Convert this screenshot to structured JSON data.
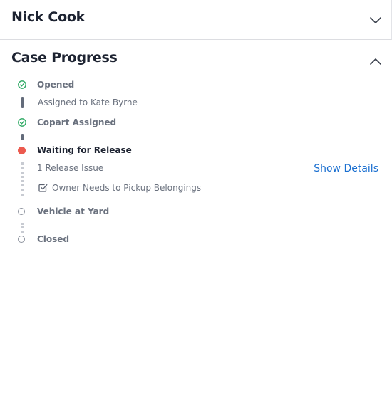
{
  "header": {
    "title": "Nick Cook"
  },
  "case_progress": {
    "title": "Case Progress",
    "steps": [
      {
        "label": "Opened",
        "status": "complete",
        "detail": "Assigned to Kate Byrne"
      },
      {
        "label": "Copart Assigned",
        "status": "complete"
      },
      {
        "label": "Waiting for Release",
        "status": "current",
        "issues_summary": "1 Release Issue",
        "action_label": "Show Details",
        "issue_item": "Owner Needs to Pickup Belongings"
      },
      {
        "label": "Vehicle at Yard",
        "status": "pending"
      },
      {
        "label": "Closed",
        "status": "pending"
      }
    ]
  },
  "colors": {
    "complete": "#2ba862",
    "current": "#ec5a4f",
    "pending": "#8a909c",
    "link": "#1a6fd0"
  },
  "icons": {
    "header_toggle": "chevron-down-icon",
    "section_toggle": "chevron-up-icon",
    "complete_step": "check-circle-icon",
    "issue_item": "checkbox-checked-icon"
  }
}
